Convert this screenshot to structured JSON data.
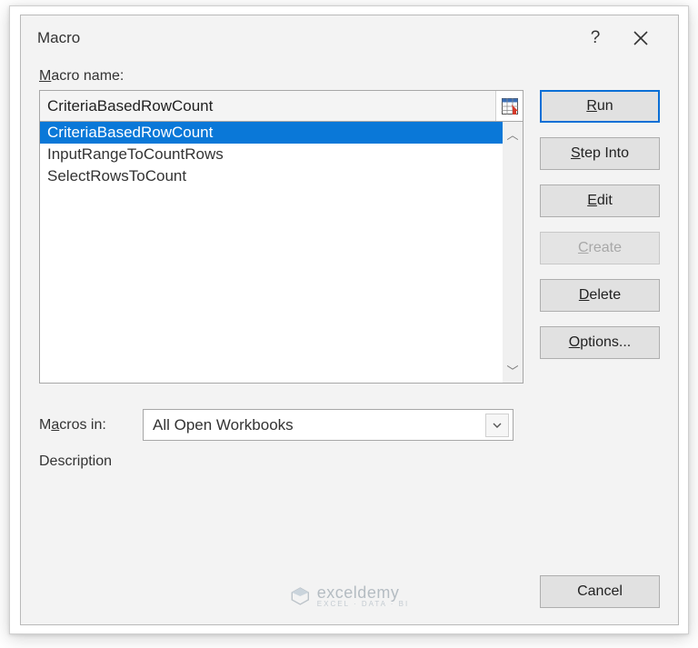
{
  "titlebar": {
    "title": "Macro",
    "help": "?",
    "close": "✕"
  },
  "labels": {
    "macro_name": "Macro name:",
    "macros_in": "Macros in:",
    "description": "Description"
  },
  "macro_name_value": "CriteriaBasedRowCount",
  "macro_list": [
    "CriteriaBasedRowCount",
    "InputRangeToCountRows",
    "SelectRowsToCount"
  ],
  "selected_index": 0,
  "macros_in_value": "All Open Workbooks",
  "buttons": {
    "run_pre": "",
    "run_ul": "R",
    "run_post": "un",
    "step_pre": "",
    "step_ul": "S",
    "step_post": "tep Into",
    "edit_pre": "",
    "edit_ul": "E",
    "edit_post": "dit",
    "create_pre": "",
    "create_ul": "C",
    "create_post": "reate",
    "delete_pre": "",
    "delete_ul": "D",
    "delete_post": "elete",
    "options_pre": "",
    "options_ul": "O",
    "options_post": "ptions...",
    "cancel": "Cancel"
  },
  "watermark": {
    "line1": "exceldemy",
    "line2": "EXCEL · DATA · BI"
  }
}
